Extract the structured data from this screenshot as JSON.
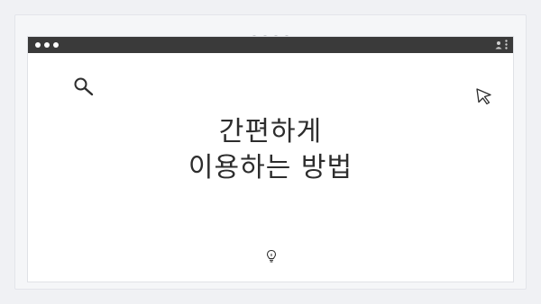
{
  "pager": {
    "dots": 4
  },
  "window": {
    "traffic_lights": 3,
    "toolbar_icons": [
      "user-icon",
      "more-vertical-icon"
    ]
  },
  "content": {
    "title_line_1": "간편하게",
    "title_line_2": "이용하는 방법",
    "icons": [
      "search-icon",
      "cursor-icon",
      "lightbulb-icon"
    ]
  },
  "colors": {
    "titlebar": "#3a3a3a",
    "background": "#f0f1f4",
    "window": "#ffffff",
    "text": "#2d2d2d"
  }
}
